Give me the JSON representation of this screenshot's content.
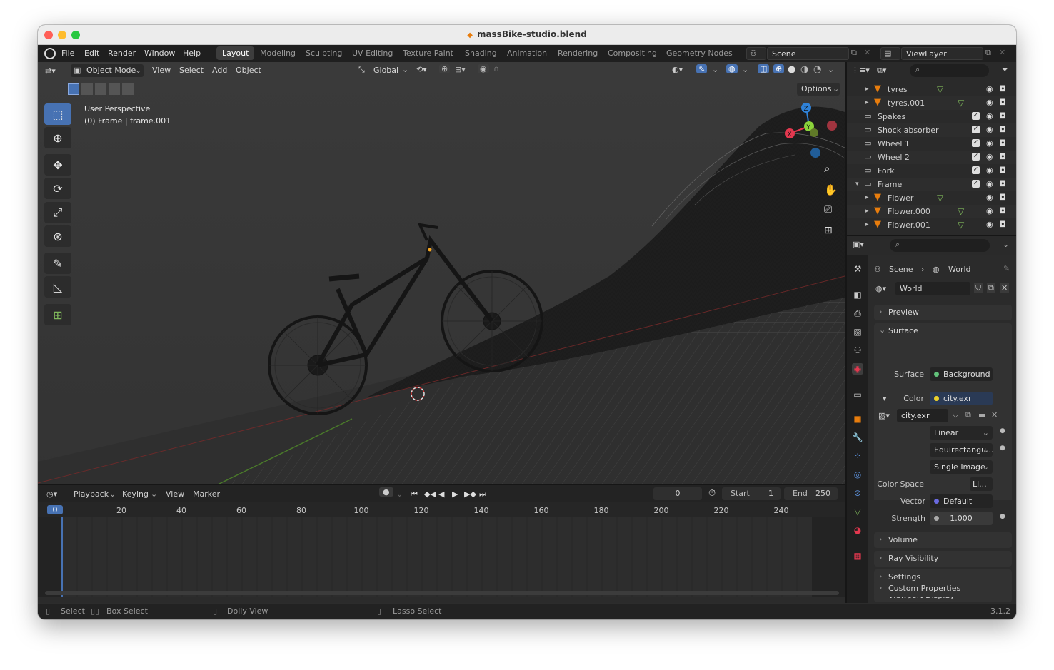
{
  "window": {
    "title": "massBike-studio.blend"
  },
  "menu": [
    "File",
    "Edit",
    "Render",
    "Window",
    "Help"
  ],
  "workspaces": [
    "Layout",
    "Modeling",
    "Sculpting",
    "UV Editing",
    "Texture Paint",
    "Shading",
    "Animation",
    "Rendering",
    "Compositing",
    "Geometry Nodes"
  ],
  "active_workspace": "Layout",
  "scene_selector": "Scene",
  "viewlayer_selector": "ViewLayer",
  "viewport": {
    "mode": "Object Mode",
    "menus": [
      "View",
      "Select",
      "Add",
      "Object"
    ],
    "orientation": "Global",
    "options_label": "Options",
    "perspective_label": "User Perspective",
    "frame_label": "(0) Frame | frame.001",
    "gizmo_axes": {
      "x": "X",
      "y": "Y",
      "z": "Z"
    }
  },
  "outliner": {
    "items": [
      {
        "name": "tyres",
        "type": "mesh",
        "indent": 2,
        "expander": "▸",
        "checkbox": false,
        "mod": true
      },
      {
        "name": "tyres.001",
        "type": "mesh",
        "indent": 2,
        "expander": "▸",
        "checkbox": false,
        "mod": true
      },
      {
        "name": "Spakes",
        "type": "collection",
        "indent": 1,
        "expander": "",
        "checkbox": true,
        "mod": false
      },
      {
        "name": "Shock absorber",
        "type": "collection",
        "indent": 1,
        "expander": "",
        "checkbox": true,
        "mod": false
      },
      {
        "name": "Wheel 1",
        "type": "collection",
        "indent": 1,
        "expander": "",
        "checkbox": true,
        "mod": false
      },
      {
        "name": "Wheel 2",
        "type": "collection",
        "indent": 1,
        "expander": "",
        "checkbox": true,
        "mod": false
      },
      {
        "name": "Fork",
        "type": "collection",
        "indent": 1,
        "expander": "",
        "checkbox": true,
        "mod": false
      },
      {
        "name": "Frame",
        "type": "collection",
        "indent": 1,
        "expander": "▾",
        "checkbox": true,
        "mod": false
      },
      {
        "name": "Flower",
        "type": "mesh",
        "indent": 2,
        "expander": "▸",
        "checkbox": false,
        "mod": true
      },
      {
        "name": "Flower.000",
        "type": "mesh",
        "indent": 2,
        "expander": "▸",
        "checkbox": false,
        "mod": true
      },
      {
        "name": "Flower.001",
        "type": "mesh",
        "indent": 2,
        "expander": "▸",
        "checkbox": false,
        "mod": true
      }
    ]
  },
  "properties": {
    "breadcrumb": {
      "scene": "Scene",
      "world": "World"
    },
    "world_name": "World",
    "panels": {
      "preview": "Preview",
      "surface": "Surface",
      "volume": "Volume",
      "ray_visibility": "Ray Visibility",
      "settings": "Settings",
      "viewport_display": "Viewport Display",
      "custom_properties": "Custom Properties"
    },
    "surface": {
      "label": "Surface",
      "value": "Background"
    },
    "color": {
      "label": "Color",
      "value": "city.exr"
    },
    "image_name": "city.exr",
    "interpolation": "Linear",
    "projection": "Equirectangu...",
    "source": "Single Image",
    "color_space": {
      "label": "Color Space",
      "value": "Li..."
    },
    "vector": {
      "label": "Vector",
      "value": "Default"
    },
    "strength": {
      "label": "Strength",
      "value": "1.000"
    }
  },
  "timeline": {
    "menus": [
      "Playback",
      "Keying",
      "View",
      "Marker"
    ],
    "current_frame": "0",
    "start_label": "Start",
    "start": "1",
    "end_label": "End",
    "end": "250",
    "ruler_labels": [
      "0",
      "20",
      "40",
      "60",
      "80",
      "100",
      "120",
      "140",
      "160",
      "180",
      "200",
      "220",
      "240"
    ]
  },
  "statusbar": {
    "select": "Select",
    "box_select": "Box Select",
    "dolly_view": "Dolly View",
    "lasso_select": "Lasso Select",
    "version": "3.1.2"
  },
  "colors": {
    "accent": "#4772b3",
    "orange": "#e87d0d",
    "mesh_green": "#7fb85b",
    "x_axis": "#e3384f",
    "y_axis": "#8bd43a",
    "z_axis": "#2f82d8"
  }
}
